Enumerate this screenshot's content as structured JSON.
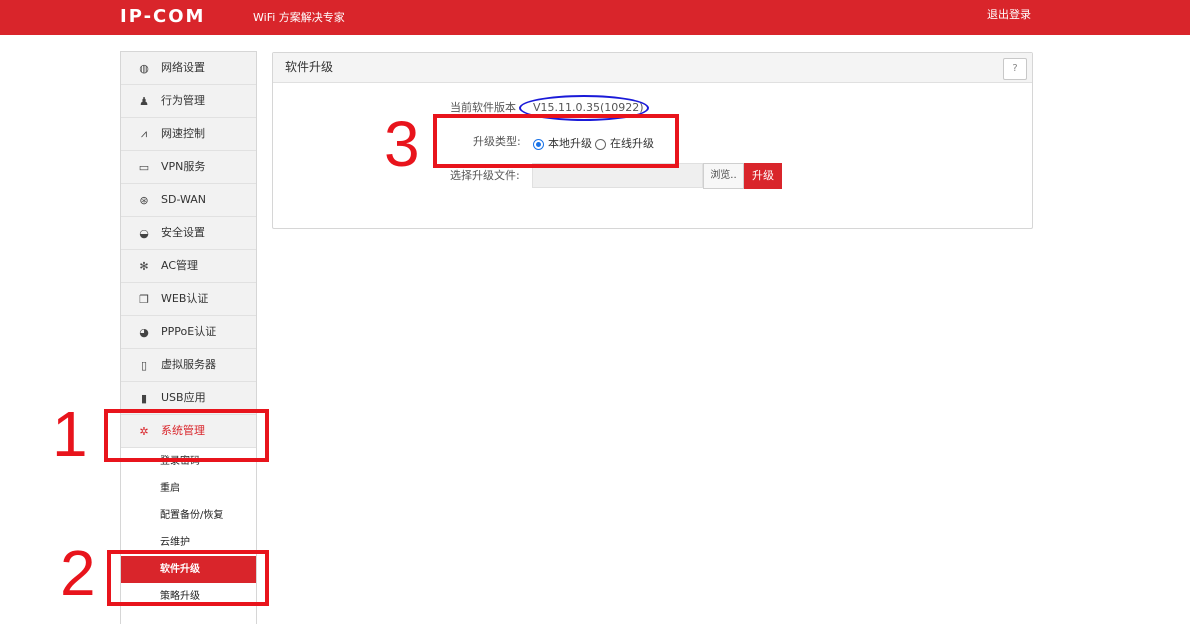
{
  "header": {
    "logo": "IP-COM",
    "slogan": "WiFi 方案解决专家",
    "logout": "退出登录"
  },
  "sidebar": {
    "items": [
      {
        "label": "网络设置",
        "icon": "globe-icon",
        "glyph": "◍"
      },
      {
        "label": "行为管理",
        "icon": "user-icon",
        "glyph": "♟"
      },
      {
        "label": "网速控制",
        "icon": "speed-chart-icon",
        "glyph": "⩘"
      },
      {
        "label": "VPN服务",
        "icon": "monitor-icon",
        "glyph": "▭"
      },
      {
        "label": "SD-WAN",
        "icon": "network-icon",
        "glyph": "⊛"
      },
      {
        "label": "安全设置",
        "icon": "shield-icon",
        "glyph": "◒"
      },
      {
        "label": "AC管理",
        "icon": "gear-icon",
        "glyph": "✻"
      },
      {
        "label": "WEB认证",
        "icon": "web-auth-icon",
        "glyph": "❐"
      },
      {
        "label": "PPPoE认证",
        "icon": "pppoe-icon",
        "glyph": "◕"
      },
      {
        "label": "虚拟服务器",
        "icon": "server-icon",
        "glyph": "▯"
      },
      {
        "label": "USB应用",
        "icon": "usb-icon",
        "glyph": "▮"
      },
      {
        "label": "系统管理",
        "icon": "system-gear-icon",
        "glyph": "✲"
      }
    ],
    "submenu": [
      {
        "label": "登录密码"
      },
      {
        "label": "重启"
      },
      {
        "label": "配置备份/恢复"
      },
      {
        "label": "云维护"
      },
      {
        "label": "软件升级"
      },
      {
        "label": "策略升级"
      }
    ]
  },
  "panel": {
    "title": "软件升级",
    "help": "?",
    "version_label": "当前软件版本",
    "version_value": "V15.11.0.35(10922)",
    "type_label": "升级类型:",
    "option_local": "本地升级",
    "option_online": "在线升级",
    "selected_option": "本地升级",
    "file_label": "选择升级文件:",
    "file_value": "",
    "browse": "浏览..",
    "upgrade": "升级"
  },
  "annotations": {
    "num1": "1",
    "num2": "2",
    "num3": "3"
  },
  "colors": {
    "brand_red": "#d9252b",
    "annotation_red": "#e8141c",
    "annotation_blue": "#1a1ad8"
  }
}
